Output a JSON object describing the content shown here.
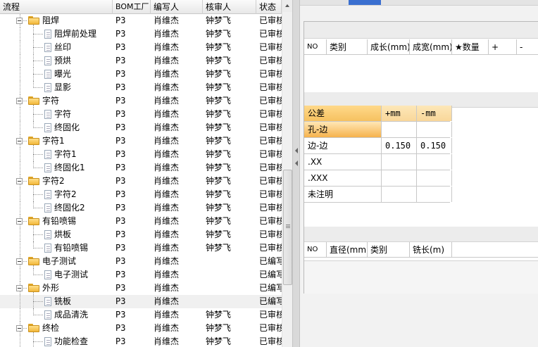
{
  "tree_grid": {
    "columns": [
      "流程",
      "BOM工厂",
      "编写人",
      "核审人",
      "状态"
    ],
    "rows": [
      {
        "depth": 0,
        "kind": "folder",
        "label": "阻焊",
        "bom": "P3",
        "writer": "肖维杰",
        "reviewer": "钟梦飞",
        "status": "已审核",
        "last": false
      },
      {
        "depth": 1,
        "kind": "doc",
        "label": "阻焊前处理",
        "bom": "P3",
        "writer": "肖维杰",
        "reviewer": "钟梦飞",
        "status": "已审核",
        "last": false
      },
      {
        "depth": 1,
        "kind": "doc",
        "label": "丝印",
        "bom": "P3",
        "writer": "肖维杰",
        "reviewer": "钟梦飞",
        "status": "已审核",
        "last": false
      },
      {
        "depth": 1,
        "kind": "doc",
        "label": "预烘",
        "bom": "P3",
        "writer": "肖维杰",
        "reviewer": "钟梦飞",
        "status": "已审核",
        "last": false
      },
      {
        "depth": 1,
        "kind": "doc",
        "label": "曝光",
        "bom": "P3",
        "writer": "肖维杰",
        "reviewer": "钟梦飞",
        "status": "已审核",
        "last": false
      },
      {
        "depth": 1,
        "kind": "doc",
        "label": "显影",
        "bom": "P3",
        "writer": "肖维杰",
        "reviewer": "钟梦飞",
        "status": "已审核",
        "last": true
      },
      {
        "depth": 0,
        "kind": "folder",
        "label": "字符",
        "bom": "P3",
        "writer": "肖维杰",
        "reviewer": "钟梦飞",
        "status": "已审核",
        "last": false
      },
      {
        "depth": 1,
        "kind": "doc",
        "label": "字符",
        "bom": "P3",
        "writer": "肖维杰",
        "reviewer": "钟梦飞",
        "status": "已审核",
        "last": false
      },
      {
        "depth": 1,
        "kind": "doc",
        "label": "终固化",
        "bom": "P3",
        "writer": "肖维杰",
        "reviewer": "钟梦飞",
        "status": "已审核",
        "last": true
      },
      {
        "depth": 0,
        "kind": "folder",
        "label": "字符1",
        "bom": "P3",
        "writer": "肖维杰",
        "reviewer": "钟梦飞",
        "status": "已审核",
        "last": false
      },
      {
        "depth": 1,
        "kind": "doc",
        "label": "字符1",
        "bom": "P3",
        "writer": "肖维杰",
        "reviewer": "钟梦飞",
        "status": "已审核",
        "last": false
      },
      {
        "depth": 1,
        "kind": "doc",
        "label": "终固化1",
        "bom": "P3",
        "writer": "肖维杰",
        "reviewer": "钟梦飞",
        "status": "已审核",
        "last": true
      },
      {
        "depth": 0,
        "kind": "folder",
        "label": "字符2",
        "bom": "P3",
        "writer": "肖维杰",
        "reviewer": "钟梦飞",
        "status": "已审核",
        "last": false
      },
      {
        "depth": 1,
        "kind": "doc",
        "label": "字符2",
        "bom": "P3",
        "writer": "肖维杰",
        "reviewer": "钟梦飞",
        "status": "已审核",
        "last": false
      },
      {
        "depth": 1,
        "kind": "doc",
        "label": "终固化2",
        "bom": "P3",
        "writer": "肖维杰",
        "reviewer": "钟梦飞",
        "status": "已审核",
        "last": true
      },
      {
        "depth": 0,
        "kind": "folder",
        "label": "有铅喷锡",
        "bom": "P3",
        "writer": "肖维杰",
        "reviewer": "钟梦飞",
        "status": "已审核",
        "last": false
      },
      {
        "depth": 1,
        "kind": "doc",
        "label": "烘板",
        "bom": "P3",
        "writer": "肖维杰",
        "reviewer": "钟梦飞",
        "status": "已审核",
        "last": false
      },
      {
        "depth": 1,
        "kind": "doc",
        "label": "有铅喷锡",
        "bom": "P3",
        "writer": "肖维杰",
        "reviewer": "钟梦飞",
        "status": "已审核",
        "last": true
      },
      {
        "depth": 0,
        "kind": "folder",
        "label": "电子测试",
        "bom": "P3",
        "writer": "肖维杰",
        "reviewer": "",
        "status": "已编写",
        "last": false
      },
      {
        "depth": 1,
        "kind": "doc",
        "label": "电子测试",
        "bom": "P3",
        "writer": "肖维杰",
        "reviewer": "",
        "status": "已编写",
        "last": true
      },
      {
        "depth": 0,
        "kind": "folder",
        "label": "外形",
        "bom": "P3",
        "writer": "肖维杰",
        "reviewer": "",
        "status": "已编写",
        "last": false
      },
      {
        "depth": 1,
        "kind": "doc",
        "label": "铣板",
        "bom": "P3",
        "writer": "肖维杰",
        "reviewer": "",
        "status": "已编写",
        "last": false,
        "selected": true
      },
      {
        "depth": 1,
        "kind": "doc",
        "label": "成品清洗",
        "bom": "P3",
        "writer": "肖维杰",
        "reviewer": "钟梦飞",
        "status": "已审核",
        "last": true
      },
      {
        "depth": 0,
        "kind": "folder",
        "label": "终检",
        "bom": "P3",
        "writer": "肖维杰",
        "reviewer": "钟梦飞",
        "status": "已审核",
        "last": false
      },
      {
        "depth": 1,
        "kind": "doc",
        "label": "功能检查",
        "bom": "P3",
        "writer": "肖维杰",
        "reviewer": "钟梦飞",
        "status": "已审核",
        "last": false
      }
    ]
  },
  "panel_top": {
    "columns": [
      "NO",
      "类别",
      "成长(mm)",
      "成宽(mm)",
      "★数量",
      "+",
      "-"
    ]
  },
  "tolerance": {
    "headers": [
      "公差",
      "+mm",
      "-mm"
    ],
    "rows": [
      {
        "name": "孔-边",
        "plus": "",
        "minus": "",
        "active": true
      },
      {
        "name": "边-边",
        "plus": "0.150",
        "minus": "0.150",
        "active": false
      },
      {
        "name": ".XX",
        "plus": "",
        "minus": "",
        "active": false
      },
      {
        "name": ".XXX",
        "plus": "",
        "minus": "",
        "active": false
      },
      {
        "name": "未注明",
        "plus": "",
        "minus": "",
        "active": false
      }
    ]
  },
  "panel_bottom": {
    "columns": [
      "NO",
      "直径(mm)",
      "类别",
      "铣长(m)"
    ]
  }
}
